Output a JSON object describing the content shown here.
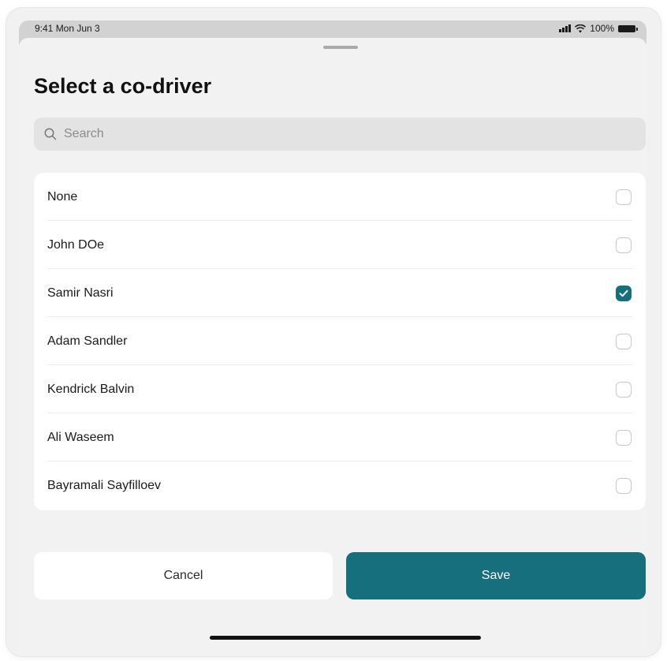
{
  "status_bar": {
    "time": "9:41 Mon Jun 3",
    "battery": "100%"
  },
  "sheet": {
    "title": "Select a co-driver",
    "search": {
      "placeholder": "Search",
      "value": ""
    },
    "drivers": [
      {
        "name": "None",
        "checked": false
      },
      {
        "name": "John DOe",
        "checked": false
      },
      {
        "name": "Samir Nasri",
        "checked": true
      },
      {
        "name": "Adam Sandler",
        "checked": false
      },
      {
        "name": "Kendrick Balvin",
        "checked": false
      },
      {
        "name": "Ali Waseem",
        "checked": false
      },
      {
        "name": "Bayramali Sayfilloev",
        "checked": false
      }
    ]
  },
  "actions": {
    "cancel_label": "Cancel",
    "save_label": "Save"
  },
  "icons": {
    "search": "search-icon",
    "checkbox_checked": "checkmark-icon",
    "signal": "cellular-signal-icon",
    "wifi": "wifi-icon",
    "battery": "battery-icon"
  },
  "colors": {
    "accent": "#156f7c",
    "sheet_background": "#f2f2f2",
    "search_background": "#e3e3e3"
  }
}
